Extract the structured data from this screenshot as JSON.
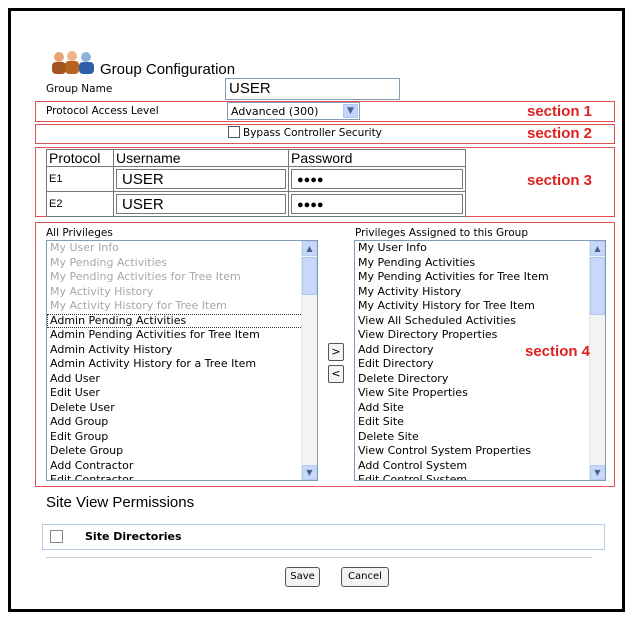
{
  "header": {
    "title": "Group Configuration"
  },
  "group_name": {
    "label": "Group Name",
    "value": "USER"
  },
  "protocol": {
    "label": "Protocol Access Level",
    "selected": "Advanced (300)"
  },
  "bypass": {
    "label": "Bypass Controller Security"
  },
  "sections": {
    "s1": "section 1",
    "s2": "section 2",
    "s3": "section 3",
    "s4": "section 4"
  },
  "credentials": {
    "headers": [
      "Protocol",
      "Username",
      "Password"
    ],
    "rows": [
      {
        "protocol": "E1",
        "username": "USER",
        "password": "●●●●"
      },
      {
        "protocol": "E2",
        "username": "USER",
        "password": "●●●●"
      }
    ]
  },
  "privileges": {
    "all_label": "All Privileges",
    "assigned_label": "Privileges Assigned to this Group",
    "all": [
      "My User Info",
      "My Pending Activities",
      "My Pending Activities for Tree Item",
      "My Activity History",
      "My Activity History for Tree Item",
      "Admin Pending Activities",
      "Admin Pending Activities for Tree Item",
      "Admin Activity History",
      "Admin Activity History for a Tree Item",
      "Add User",
      "Edit User",
      "Delete User",
      "Add Group",
      "Edit Group",
      "Delete Group",
      "Add Contractor",
      "Edit Contractor"
    ],
    "assigned": [
      "My User Info",
      "My Pending Activities",
      "My Pending Activities for Tree Item",
      "My Activity History",
      "My Activity History for Tree Item",
      "View All Scheduled Activities",
      "View Directory Properties",
      "Add Directory",
      "Edit Directory",
      "Delete Directory",
      "View Site Properties",
      "Add Site",
      "Edit Site",
      "Delete Site",
      "View Control System Properties",
      "Add Control System",
      "Edit Control System"
    ],
    "add_label": ">",
    "remove_label": "<"
  },
  "site_view": {
    "title": "Site View Permissions",
    "directories_label": "Site Directories"
  },
  "buttons": {
    "save": "Save",
    "cancel": "Cancel"
  },
  "colors": {
    "section_red": "#e02020",
    "border_red": "#e05050",
    "field_border": "#7f9db9",
    "scroll_blue": "#c7d8fb"
  },
  "icons": {
    "group": "group-users-icon"
  }
}
